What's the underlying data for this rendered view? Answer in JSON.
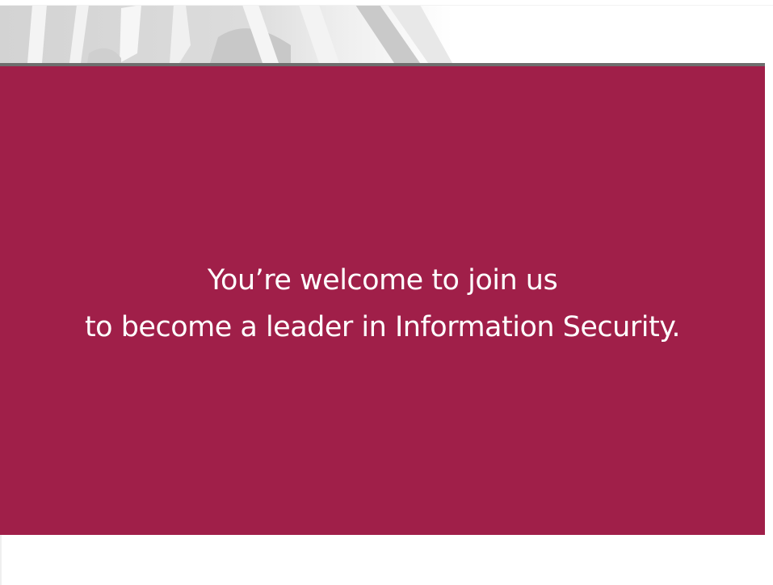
{
  "hero": {
    "image": "faded-grey-engraving"
  },
  "banner": {
    "background_color": "#a01f49",
    "text_color": "#ffffff",
    "line1": "You’re welcome to join us",
    "line2": "to become a leader in Information Security."
  }
}
